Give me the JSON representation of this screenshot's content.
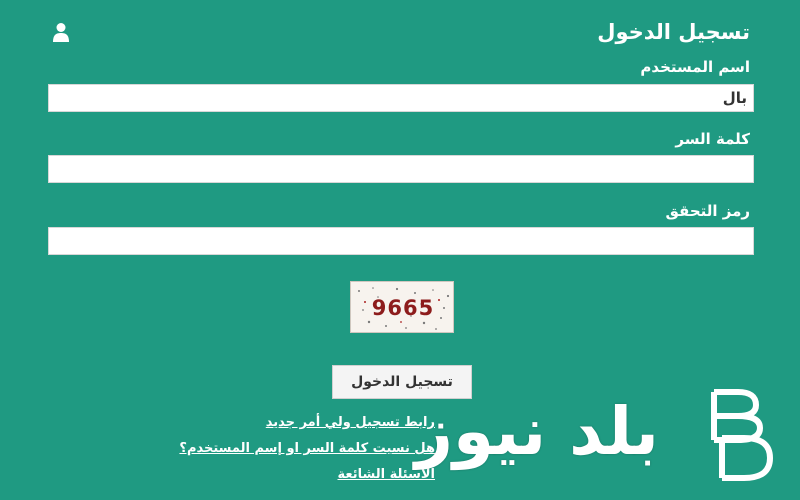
{
  "login": {
    "title": "تسجيل الدخول",
    "username_label": "اسم المستخدم",
    "username_value": "بال",
    "password_label": "كلمة السر",
    "password_value": "",
    "captcha_label": "رمز التحقق",
    "captcha_value": "",
    "captcha_code": "9665",
    "submit_label": "تسجيل الدخول"
  },
  "links": {
    "register": "رابط تسجيل ولي أمر جديد",
    "forgot": "هل نسيت كلمة السر او إسم المستخدم؟",
    "faq": "الأسئلة الشائعة"
  },
  "watermark": {
    "text": "بلد نيوز",
    "logo_letters": "BD"
  },
  "colors": {
    "background": "#1f9a82",
    "captcha_text": "#8d1c1c"
  },
  "icons": {
    "user": "user-icon"
  }
}
